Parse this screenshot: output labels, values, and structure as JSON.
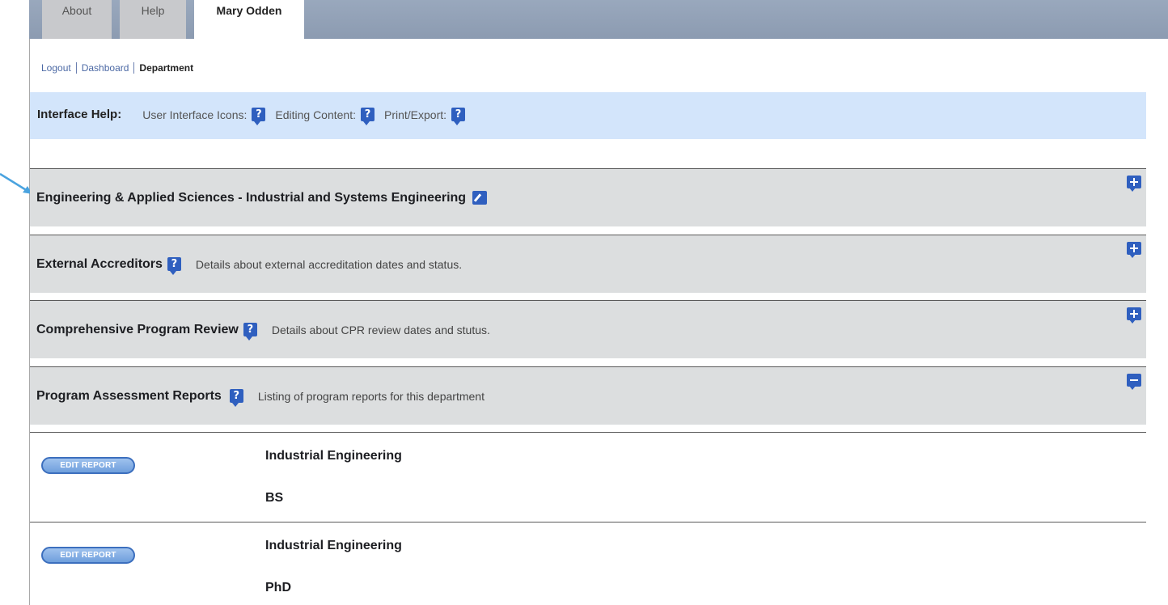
{
  "tabs": [
    {
      "label": "About",
      "active": false
    },
    {
      "label": "Help",
      "active": false
    },
    {
      "label": "Mary Odden",
      "active": true
    }
  ],
  "breadcrumb": {
    "logout": "Logout",
    "dashboard": "Dashboard",
    "current": "Department"
  },
  "interface_help": {
    "title": "Interface Help:",
    "items": [
      {
        "label": "User Interface Icons:",
        "icon": "help-icon"
      },
      {
        "label": "Editing Content:",
        "icon": "help-icon"
      },
      {
        "label": "Print/Export:",
        "icon": "help-icon"
      }
    ]
  },
  "sections": [
    {
      "title": "Engineering & Applied Sciences - Industrial and Systems Engineering",
      "icon": "edit-icon",
      "description": "",
      "toggle": "expand"
    },
    {
      "title": "External Accreditors",
      "icon": "help-icon",
      "description": "Details about external accreditation dates and status.",
      "toggle": "expand"
    },
    {
      "title": "Comprehensive Program Review",
      "icon": "help-icon",
      "description": "Details about CPR review dates and stutus.",
      "toggle": "expand"
    },
    {
      "title": "Program Assessment Reports",
      "icon": "help-icon",
      "description": "Listing of program reports for this department",
      "toggle": "collapse"
    }
  ],
  "reports": [
    {
      "button": "EDIT REPORT",
      "program": "Industrial Engineering",
      "degree": "BS"
    },
    {
      "button": "EDIT REPORT",
      "program": "Industrial Engineering",
      "degree": "PhD"
    }
  ],
  "colors": {
    "accent": "#2f5fbf",
    "help_bar": "#d3e5fb",
    "section_bg": "#dcdedf",
    "topbar": "#8c9bb1",
    "arrow": "#4aa3df"
  }
}
